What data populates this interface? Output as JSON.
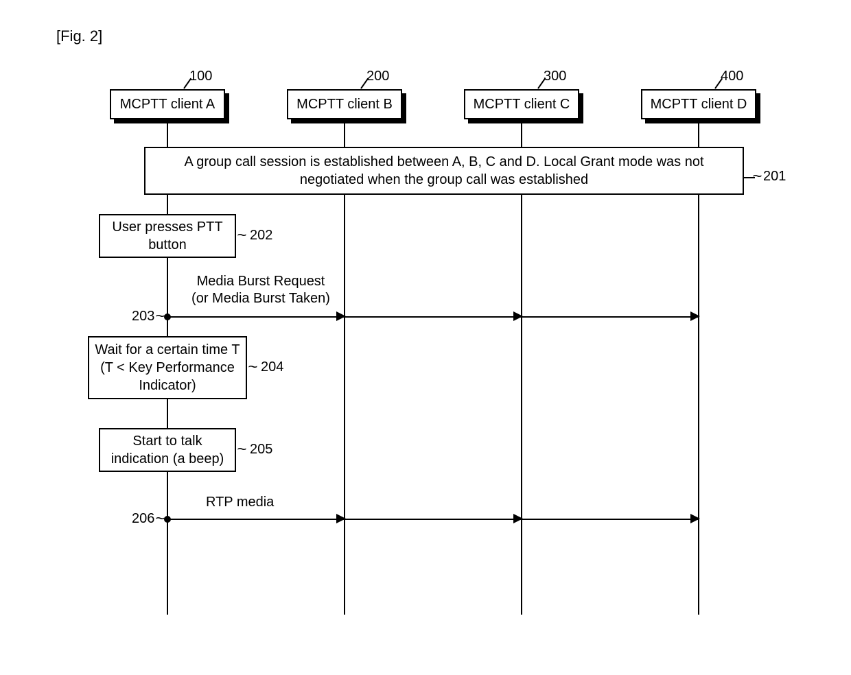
{
  "figure_label": "[Fig. 2]",
  "participants": {
    "a": {
      "label": "MCPTT client A",
      "ref": "100"
    },
    "b": {
      "label": "MCPTT client B",
      "ref": "200"
    },
    "c": {
      "label": "MCPTT client C",
      "ref": "300"
    },
    "d": {
      "label": "MCPTT client D",
      "ref": "400"
    }
  },
  "steps": {
    "201": {
      "ref": "201",
      "text": "A group call session is established between A, B, C and D. Local Grant mode was not negotiated when the group call was established"
    },
    "202": {
      "ref": "202",
      "text": "User presses PTT button"
    },
    "203": {
      "ref": "203",
      "label_line1": "Media Burst Request",
      "label_line2": "(or Media Burst Taken)"
    },
    "204": {
      "ref": "204",
      "text": "Wait for a certain time T (T < Key Performance Indicator)"
    },
    "205": {
      "ref": "205",
      "text": "Start to talk indication (a beep)"
    },
    "206": {
      "ref": "206",
      "label": "RTP media"
    }
  }
}
